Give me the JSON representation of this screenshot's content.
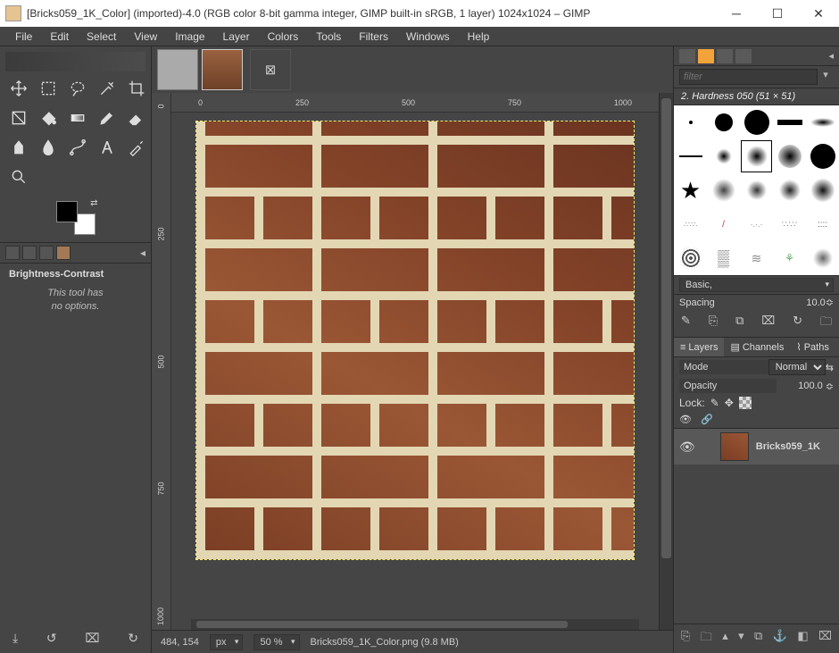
{
  "titlebar": {
    "title": "[Bricks059_1K_Color] (imported)-4.0 (RGB color 8-bit gamma integer, GIMP built-in sRGB, 1 layer) 1024x1024 – GIMP"
  },
  "menu": {
    "file": "File",
    "edit": "Edit",
    "select": "Select",
    "view": "View",
    "image": "Image",
    "layer": "Layer",
    "colors": "Colors",
    "tools": "Tools",
    "filters": "Filters",
    "windows": "Windows",
    "help": "Help"
  },
  "tool_options": {
    "title": "Brightness-Contrast",
    "line1": "This tool has",
    "line2": "no options."
  },
  "ruler_h": {
    "t0": "0",
    "t250": "250",
    "t500": "500",
    "t750": "750",
    "t1000": "1000"
  },
  "ruler_v": {
    "t0": "0",
    "t250": "250",
    "t500": "500",
    "t750": "750",
    "t1000": "1000"
  },
  "statusbar": {
    "coords": "484, 154",
    "unit": "px",
    "zoom": "50 %",
    "file": "Bricks059_1K_Color.png (9.8 MB)"
  },
  "brushes": {
    "filter_placeholder": "filter",
    "label": "2. Hardness 050 (51 × 51)",
    "preset": "Basic,",
    "spacing_label": "Spacing",
    "spacing_value": "10.0"
  },
  "layers": {
    "tab_layers": "Layers",
    "tab_channels": "Channels",
    "tab_paths": "Paths",
    "mode_label": "Mode",
    "mode_value": "Normal",
    "opacity_label": "Opacity",
    "opacity_value": "100.0",
    "lock_label": "Lock:",
    "row_name": "Bricks059_1K"
  }
}
